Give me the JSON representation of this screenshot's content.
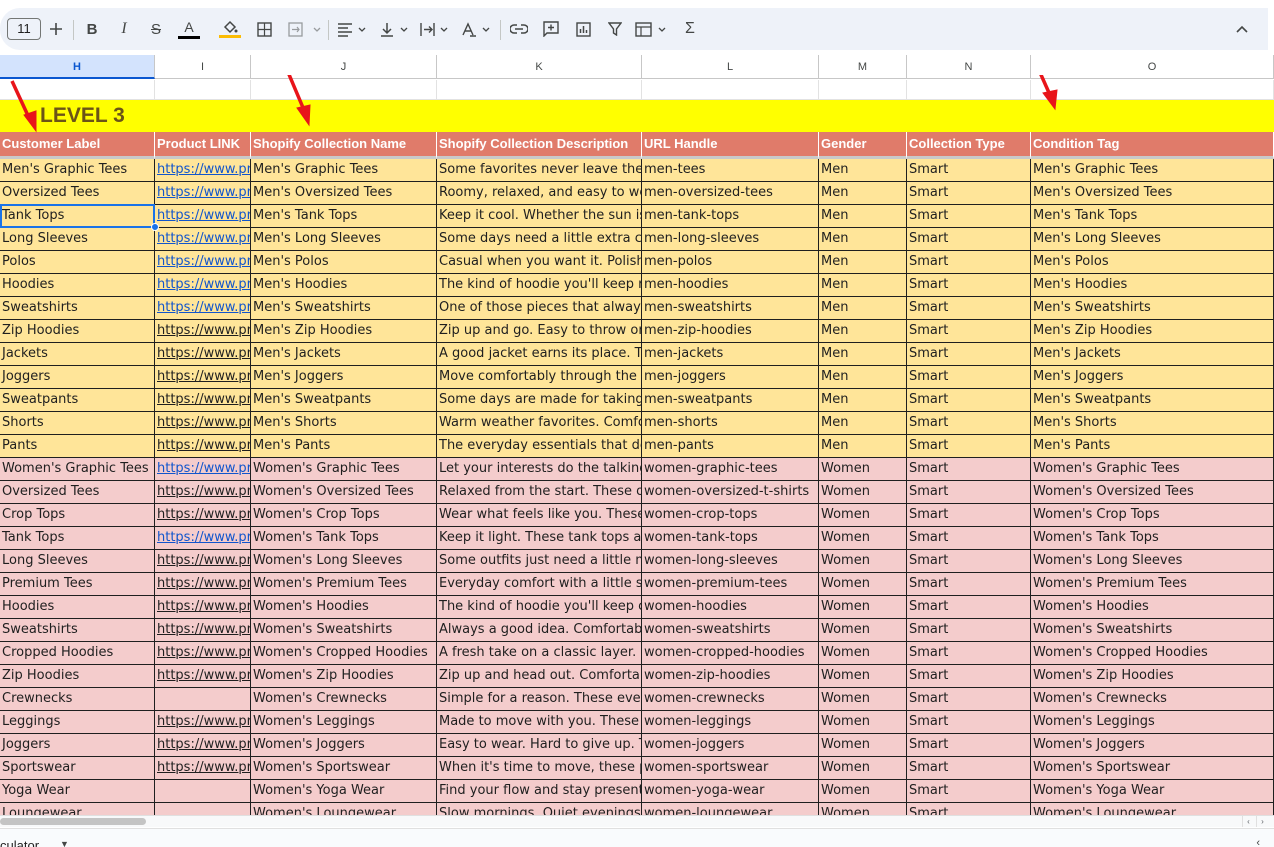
{
  "toolbar": {
    "font_size": "11",
    "icons": [
      "plus-icon",
      "bold-icon",
      "italic-icon",
      "strikethrough-icon",
      "text-color-icon",
      "fill-color-icon",
      "borders-icon",
      "merge-cells-icon",
      "align-left-icon",
      "vertical-align-icon",
      "text-wrap-icon",
      "text-rotation-icon",
      "link-icon",
      "comment-icon",
      "chart-icon",
      "filter-icon",
      "filter-views-icon",
      "functions-icon",
      "collapse-icon"
    ],
    "text_color": "#000000",
    "fill_color": "#fbbc04"
  },
  "columns": [
    {
      "letter": "H",
      "selected": true
    },
    {
      "letter": "I"
    },
    {
      "letter": "J"
    },
    {
      "letter": "K"
    },
    {
      "letter": "L"
    },
    {
      "letter": "M"
    },
    {
      "letter": "N"
    },
    {
      "letter": "O"
    }
  ],
  "level_title": "LEVEL 3",
  "headers": [
    "Customer Label",
    "Product LINK",
    "Shopify Collection Name",
    "Shopify Collection Description",
    "URL Handle",
    "Gender",
    "Collection Type",
    "Condition Tag"
  ],
  "colors": {
    "level_bg": "#ffff00",
    "header_bg": "#e07b6a",
    "men_bg": "#ffe599",
    "women_bg": "#f4cccc",
    "link": "#1155cc",
    "arrow": "#e8141a"
  },
  "rows": [
    {
      "group": "men",
      "label": "Men's Graphic Tees",
      "link": "https://www.pr",
      "link_blue": true,
      "name": "Men's Graphic Tees",
      "desc": "Some favorites never leave the ro",
      "handle": "men-tees",
      "gender": "Men",
      "type": "Smart",
      "tag": "Men's Graphic Tees"
    },
    {
      "group": "men",
      "label": "Oversized Tees",
      "link": "https://www.pr",
      "link_blue": true,
      "name": "Men's Oversized Tees",
      "desc": "Roomy, relaxed, and easy to wear.",
      "handle": "men-oversized-tees",
      "gender": "Men",
      "type": "Smart",
      "tag": "Men's Oversized Tees"
    },
    {
      "group": "men",
      "label": "Tank Tops",
      "link": "https://www.pr",
      "link_blue": true,
      "name": "Men's Tank Tops",
      "desc": "Keep it cool. Whether the sun is o",
      "handle": "men-tank-tops",
      "gender": "Men",
      "type": "Smart",
      "tag": "Men's Tank Tops"
    },
    {
      "group": "men",
      "label": "Long Sleeves",
      "link": "https://www.pr",
      "link_blue": true,
      "name": "Men's Long Sleeves",
      "desc": "Some days need a little extra cove",
      "handle": "men-long-sleeves",
      "gender": "Men",
      "type": "Smart",
      "tag": "Men's Long Sleeves"
    },
    {
      "group": "men",
      "label": "Polos",
      "link": "https://www.pr",
      "link_blue": true,
      "name": "Men's Polos",
      "desc": "Casual when you want it. Polished",
      "handle": "men-polos",
      "gender": "Men",
      "type": "Smart",
      "tag": "Men's Polos"
    },
    {
      "group": "men",
      "label": "Hoodies",
      "link": "https://www.pr",
      "link_blue": true,
      "name": "Men's Hoodies",
      "desc": "The kind of hoodie you'll keep rea",
      "handle": "men-hoodies",
      "gender": "Men",
      "type": "Smart",
      "tag": "Men's Hoodies"
    },
    {
      "group": "men",
      "label": "Sweatshirts",
      "link": "https://www.pr",
      "link_blue": true,
      "name": "Men's Sweatshirts",
      "desc": "One of those pieces that always co",
      "handle": "men-sweatshirts",
      "gender": "Men",
      "type": "Smart",
      "tag": "Men's Sweatshirts"
    },
    {
      "group": "men",
      "label": "Zip Hoodies",
      "link": "https://www.pr",
      "link_blue": false,
      "name": "Men's Zip Hoodies",
      "desc": "Zip up and go. Easy to throw on, e",
      "handle": "men-zip-hoodies",
      "gender": "Men",
      "type": "Smart",
      "tag": "Men's Zip Hoodies"
    },
    {
      "group": "men",
      "label": "Jackets",
      "link": "https://www.pr",
      "link_blue": false,
      "name": "Men's Jackets",
      "desc": "A good jacket earns its place. Thes",
      "handle": "men-jackets",
      "gender": "Men",
      "type": "Smart",
      "tag": "Men's Jackets"
    },
    {
      "group": "men",
      "label": "Joggers",
      "link": "https://www.pr",
      "link_blue": false,
      "name": "Men's Joggers",
      "desc": "Move comfortably through the da",
      "handle": "men-joggers",
      "gender": "Men",
      "type": "Smart",
      "tag": "Men's Joggers"
    },
    {
      "group": "men",
      "label": "Sweatpants",
      "link": "https://www.pr",
      "link_blue": false,
      "name": "Men's Sweatpants",
      "desc": "Some days are made for taking it e",
      "handle": "men-sweatpants",
      "gender": "Men",
      "type": "Smart",
      "tag": "Men's Sweatpants"
    },
    {
      "group": "men",
      "label": "Shorts",
      "link": "https://www.pr",
      "link_blue": false,
      "name": "Men's Shorts",
      "desc": "Warm weather favorites. Comfort",
      "handle": "men-shorts",
      "gender": "Men",
      "type": "Smart",
      "tag": "Men's Shorts"
    },
    {
      "group": "men",
      "label": "Pants",
      "link": "https://www.pr",
      "link_blue": false,
      "name": "Men's Pants",
      "desc": "The everyday essentials that do th",
      "handle": "men-pants",
      "gender": "Men",
      "type": "Smart",
      "tag": "Men's Pants"
    },
    {
      "group": "women",
      "label": "Women's Graphic Tees",
      "link": "https://www.pr",
      "link_blue": true,
      "name": "Women's Graphic Tees",
      "desc": "Let your interests do the talking. O",
      "handle": "women-graphic-tees",
      "gender": "Women",
      "type": "Smart",
      "tag": "Women's Graphic Tees"
    },
    {
      "group": "women",
      "label": "Oversized Tees",
      "link": "https://www.pr",
      "link_blue": false,
      "name": "Women's Oversized Tees",
      "desc": "Relaxed from the start. These ove",
      "handle": "women-oversized-t-shirts",
      "gender": "Women",
      "type": "Smart",
      "tag": "Women's Oversized Tees"
    },
    {
      "group": "women",
      "label": "Crop Tops",
      "link": "https://www.pr",
      "link_blue": false,
      "name": "Women's Crop Tops",
      "desc": "Wear what feels like you. These cr",
      "handle": "women-crop-tops",
      "gender": "Women",
      "type": "Smart",
      "tag": "Women's Crop Tops"
    },
    {
      "group": "women",
      "label": "Tank Tops",
      "link": "https://www.pr",
      "link_blue": true,
      "name": "Women's Tank Tops",
      "desc": "Keep it light. These tank tops are r",
      "handle": "women-tank-tops",
      "gender": "Women",
      "type": "Smart",
      "tag": "Women's Tank Tops"
    },
    {
      "group": "women",
      "label": "Long Sleeves",
      "link": "https://www.pr",
      "link_blue": false,
      "name": "Women's Long Sleeves",
      "desc": "Some outfits just need a little mor",
      "handle": "women-long-sleeves",
      "gender": "Women",
      "type": "Smart",
      "tag": "Women's Long Sleeves"
    },
    {
      "group": "women",
      "label": "Premium Tees",
      "link": "https://www.pr",
      "link_blue": false,
      "name": "Women's Premium Tees",
      "desc": "Everyday comfort with a little som",
      "handle": "women-premium-tees",
      "gender": "Women",
      "type": "Smart",
      "tag": "Women's Premium Tees"
    },
    {
      "group": "women",
      "label": "Hoodies",
      "link": "https://www.pr",
      "link_blue": false,
      "name": "Women's Hoodies",
      "desc": "The kind of hoodie you'll keep clos",
      "handle": "women-hoodies",
      "gender": "Women",
      "type": "Smart",
      "tag": "Women's Hoodies"
    },
    {
      "group": "women",
      "label": "Sweatshirts",
      "link": "https://www.pr",
      "link_blue": false,
      "name": "Women's Sweatshirts",
      "desc": "Always a good idea. Comfortable s",
      "handle": "women-sweatshirts",
      "gender": "Women",
      "type": "Smart",
      "tag": "Women's Sweatshirts"
    },
    {
      "group": "women",
      "label": "Cropped Hoodies",
      "link": "https://www.pr",
      "link_blue": false,
      "name": "Women's Cropped Hoodies",
      "desc": "A fresh take on a classic layer. Cro",
      "handle": "women-cropped-hoodies",
      "gender": "Women",
      "type": "Smart",
      "tag": "Women's Cropped Hoodies"
    },
    {
      "group": "women",
      "label": "Zip Hoodies",
      "link": "https://www.pr",
      "link_blue": false,
      "name": "Women's Zip Hoodies",
      "desc": "Zip up and head out. Comfortable",
      "handle": "women-zip-hoodies",
      "gender": "Women",
      "type": "Smart",
      "tag": "Women's Zip Hoodies"
    },
    {
      "group": "women",
      "label": "Crewnecks",
      "link": "",
      "link_blue": false,
      "name": "Women's Crewnecks",
      "desc": "Simple for a reason. These everyd",
      "handle": "women-crewnecks",
      "gender": "Women",
      "type": "Smart",
      "tag": "Women's Crewnecks"
    },
    {
      "group": "women",
      "label": "Leggings",
      "link": "https://www.pr",
      "link_blue": false,
      "name": "Women's Leggings",
      "desc": "Made to move with you. These leg",
      "handle": "women-leggings",
      "gender": "Women",
      "type": "Smart",
      "tag": "Women's Leggings"
    },
    {
      "group": "women",
      "label": "Joggers",
      "link": "https://www.pr",
      "link_blue": false,
      "name": "Women's Joggers",
      "desc": "Easy to wear. Hard to give up. The",
      "handle": "women-joggers",
      "gender": "Women",
      "type": "Smart",
      "tag": "Women's Joggers"
    },
    {
      "group": "women",
      "label": "Sportswear",
      "link": "https://www.pr",
      "link_blue": false,
      "name": "Women's Sportswear",
      "desc": "When it's time to move, these pie",
      "handle": "women-sportswear",
      "gender": "Women",
      "type": "Smart",
      "tag": "Women's Sportswear"
    },
    {
      "group": "women",
      "label": "Yoga Wear",
      "link": "",
      "link_blue": false,
      "name": "Women's Yoga Wear",
      "desc": "Find your flow and stay present. O",
      "handle": "women-yoga-wear",
      "gender": "Women",
      "type": "Smart",
      "tag": "Women's Yoga Wear"
    },
    {
      "group": "women",
      "label": "Loungewear",
      "link": "",
      "link_blue": false,
      "name": "Women's Loungewear",
      "desc": "Slow mornings. Quiet evenings. C",
      "handle": "women-loungewear",
      "gender": "Women",
      "type": "Smart",
      "tag": "Women's Loungewear"
    }
  ],
  "sheet_tab": "culator"
}
